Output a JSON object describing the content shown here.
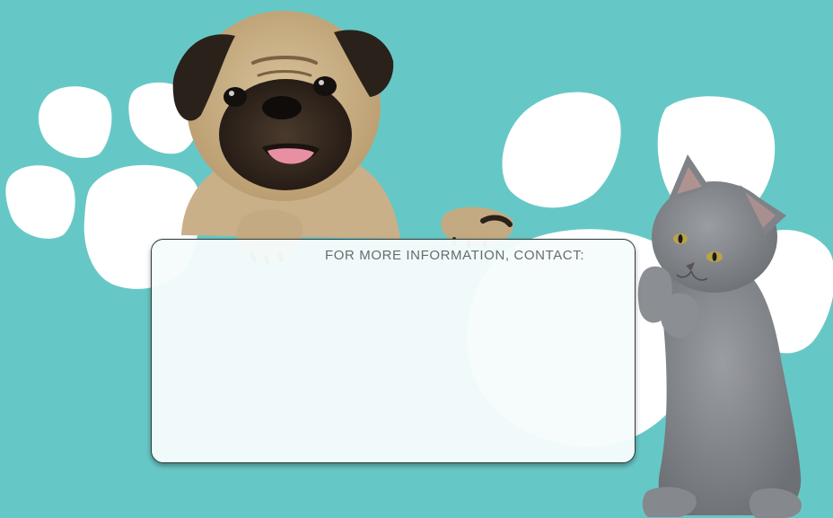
{
  "flyer": {
    "contact_label": "FOR MORE INFORMATION, CONTACT:"
  },
  "colors": {
    "background": "#66c8c6",
    "paw_print": "#ffffff",
    "card": "#f6fcfc",
    "card_border": "#2b3b3b",
    "label_text": "#6a6a6a"
  },
  "images": {
    "pug": "pug-puppy-photo",
    "kitten": "gray-kitten-photo"
  }
}
